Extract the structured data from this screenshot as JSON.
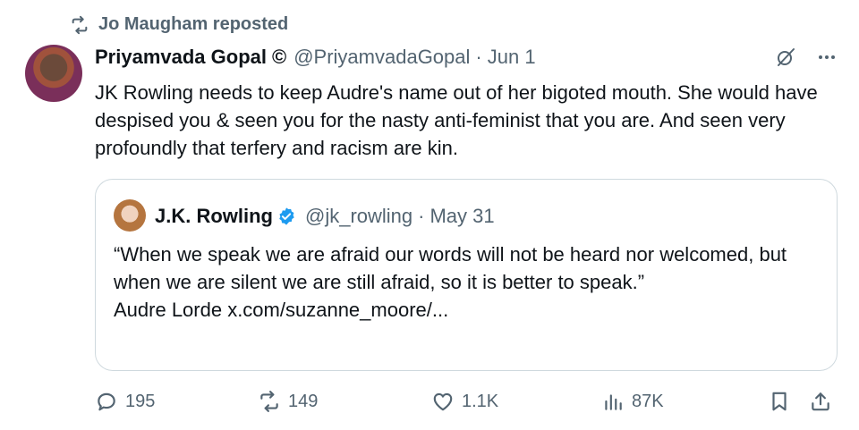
{
  "repost": {
    "label": "Jo Maugham reposted",
    "icon": "repost-icon"
  },
  "post": {
    "author_name": "Priyamvada Gopal",
    "author_mark": "©",
    "handle": "@PriyamvadaGopal",
    "separator": "·",
    "date": "Jun 1",
    "text": "JK Rowling needs to keep Audre's name out of her bigoted mouth. She would have despised you & seen you for the nasty anti-feminist that you are. And seen very profoundly that terfery and racism are kin."
  },
  "quote": {
    "author_name": "J.K. Rowling",
    "handle": "@jk_rowling",
    "separator": "·",
    "date": "May 31",
    "text_line1": "“When we speak we are afraid our words will not be heard nor welcomed, but when we are silent we are still afraid, so it is better to speak.”",
    "text_line2": "Audre Lorde x.com/suzanne_moore/..."
  },
  "actions": {
    "replies": "195",
    "reposts": "149",
    "likes": "1.1K",
    "views": "87K"
  },
  "colors": {
    "muted": "#536471",
    "text": "#0f1419",
    "verified": "#1d9bf0",
    "border": "#cfd9de"
  }
}
